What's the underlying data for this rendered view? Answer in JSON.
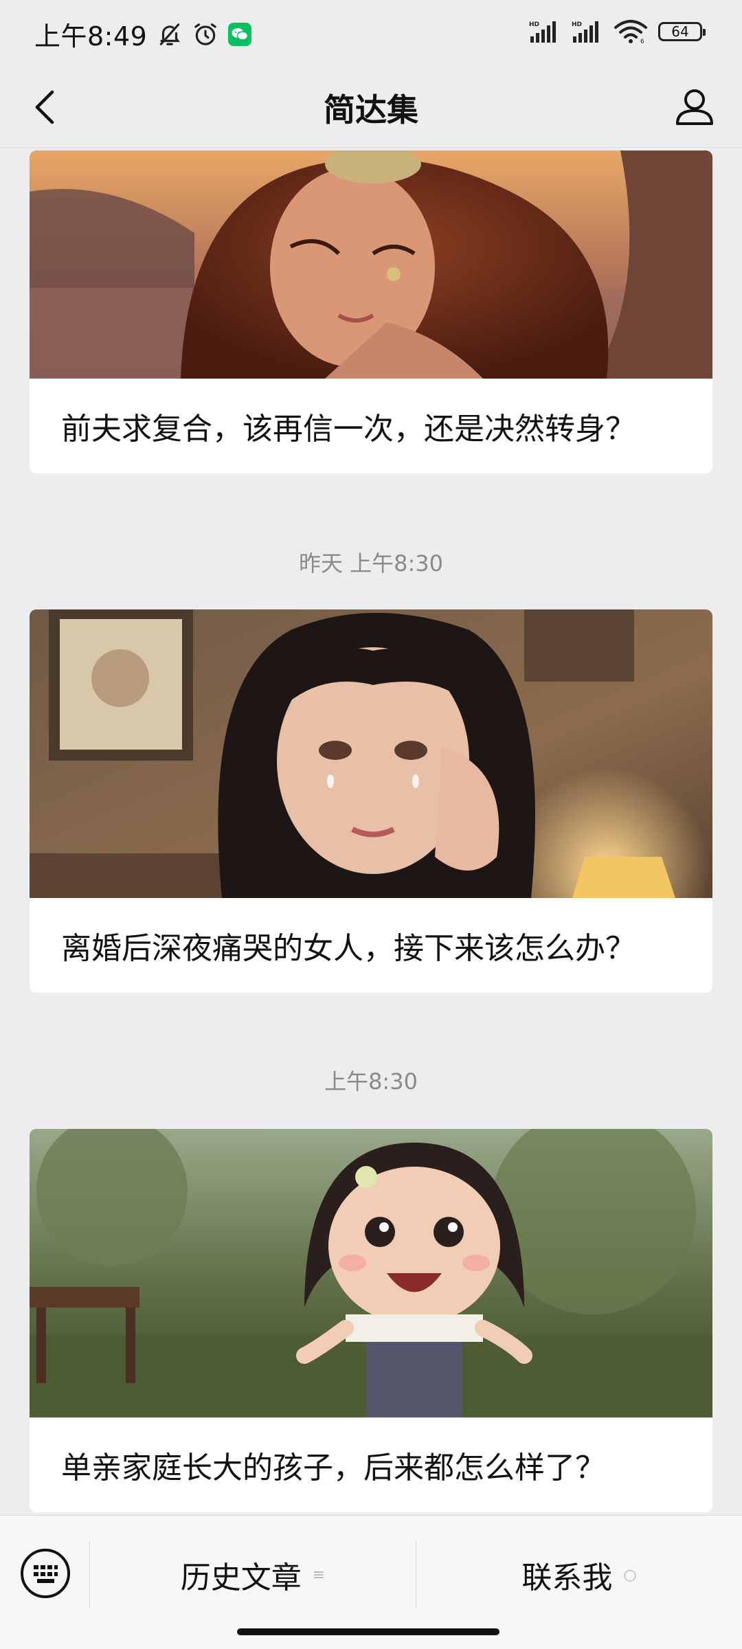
{
  "status_bar": {
    "time": "上午8:49",
    "signal_label_1": "HD",
    "signal_label_2": "HD",
    "wifi_sub": "6",
    "battery": "64"
  },
  "nav": {
    "title": "简达集"
  },
  "feed": [
    {
      "timestamp": "",
      "caption": "前夫求复合，该再信一次，还是决然转身？",
      "image_icon": "girl-sunset-illustration"
    },
    {
      "timestamp": "昨天 上午8:30",
      "caption": "离婚后深夜痛哭的女人，接下来该怎么办？",
      "image_icon": "crying-woman-illustration"
    },
    {
      "timestamp": "上午8:30",
      "caption": "单亲家庭长大的孩子，后来都怎么样了？",
      "image_icon": "happy-child-illustration"
    }
  ],
  "bottom_menu": {
    "item1": "历史文章",
    "item1_glyph": "≡",
    "item2": "联系我",
    "item2_glyph": "○"
  },
  "colors": {
    "background": "#ededed",
    "card": "#ffffff",
    "wechat_green": "#07c160",
    "timestamp_text": "#8a8a8a"
  }
}
